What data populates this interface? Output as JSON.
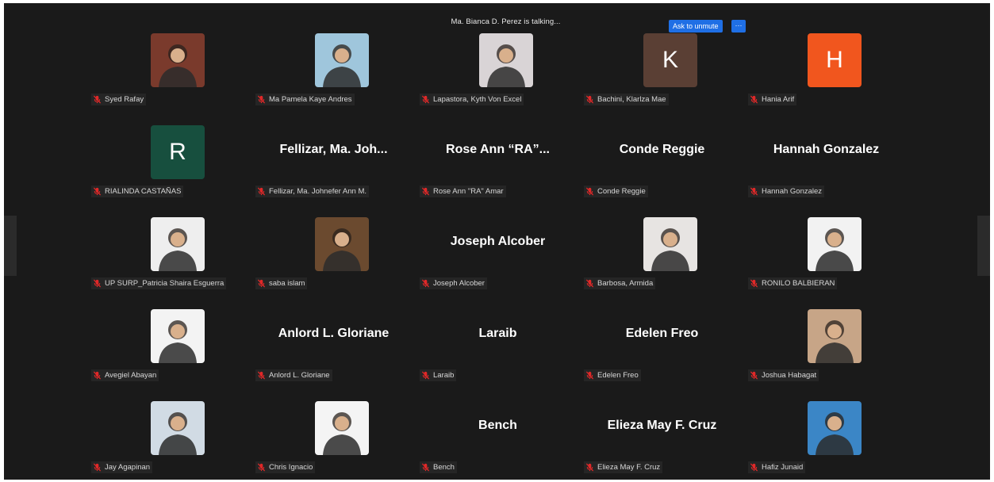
{
  "speaker_banner": "Ma. Bianca D. Perez is talking...",
  "ask_unmute_label": "Ask to unmute",
  "more_label": "···",
  "colors": {
    "accent": "#1f6fe5",
    "mic_muted": "#e02828",
    "bg": "#1a1a1a"
  },
  "participants": [
    {
      "label": "Syed Rafay",
      "kind": "photo",
      "bg": "#7a3a2c"
    },
    {
      "label": "Ma Pamela Kaye Andres",
      "kind": "photo",
      "bg": "#9fc6dc"
    },
    {
      "label": "Lapastora, Kyth Von Excel",
      "kind": "photo",
      "bg": "#d9d4d6"
    },
    {
      "label": "Bachini, Klarlza Mae",
      "kind": "letter",
      "letter": "K",
      "bg": "#5a3f34"
    },
    {
      "label": "Hania Arif",
      "kind": "letter",
      "letter": "H",
      "bg": "#f1561e"
    },
    {
      "label": "RIALINDA CASTAÑAS",
      "kind": "letter",
      "letter": "R",
      "bg": "#174f3e"
    },
    {
      "label": "Fellizar,  Ma. Johnefer Ann M.",
      "kind": "name",
      "display": "Fellizar,  Ma. Joh..."
    },
    {
      "label": "Rose Ann \"RA\" Amar",
      "kind": "name",
      "display": "Rose Ann “RA”..."
    },
    {
      "label": "Conde Reggie",
      "kind": "name",
      "display": "Conde Reggie"
    },
    {
      "label": "Hannah Gonzalez",
      "kind": "name",
      "display": "Hannah Gonzalez"
    },
    {
      "label": "UP SURP_Patricia Shaira Esguerra",
      "kind": "photo",
      "bg": "#eeeeee"
    },
    {
      "label": "saba islam",
      "kind": "photo",
      "bg": "#6b4a2f"
    },
    {
      "label": "Joseph Alcober",
      "kind": "name",
      "display": "Joseph Alcober"
    },
    {
      "label": "Barbosa, Armida",
      "kind": "photo",
      "bg": "#e7e4e2"
    },
    {
      "label": "RONILO BALBIERAN",
      "kind": "photo",
      "bg": "#f2f2f2"
    },
    {
      "label": "Avegiel Abayan",
      "kind": "photo",
      "bg": "#f3f3f3"
    },
    {
      "label": "Anlord L. Gloriane",
      "kind": "name",
      "display": "Anlord L. Gloriane"
    },
    {
      "label": "Laraib",
      "kind": "name",
      "display": "Laraib"
    },
    {
      "label": "Edelen Freo",
      "kind": "name",
      "display": "Edelen Freo"
    },
    {
      "label": "Joshua Habagat",
      "kind": "photo",
      "bg": "#c7a587"
    },
    {
      "label": "Jay Agapinan",
      "kind": "photo",
      "bg": "#d1dbe4"
    },
    {
      "label": "Chris Ignacio",
      "kind": "photo",
      "bg": "#f4f4f4"
    },
    {
      "label": "Bench",
      "kind": "name",
      "display": "Bench"
    },
    {
      "label": "Elieza May F. Cruz",
      "kind": "name",
      "display": "Elieza May F. Cruz"
    },
    {
      "label": "Hafiz Junaid",
      "kind": "photo",
      "bg": "#3b86c6"
    }
  ]
}
